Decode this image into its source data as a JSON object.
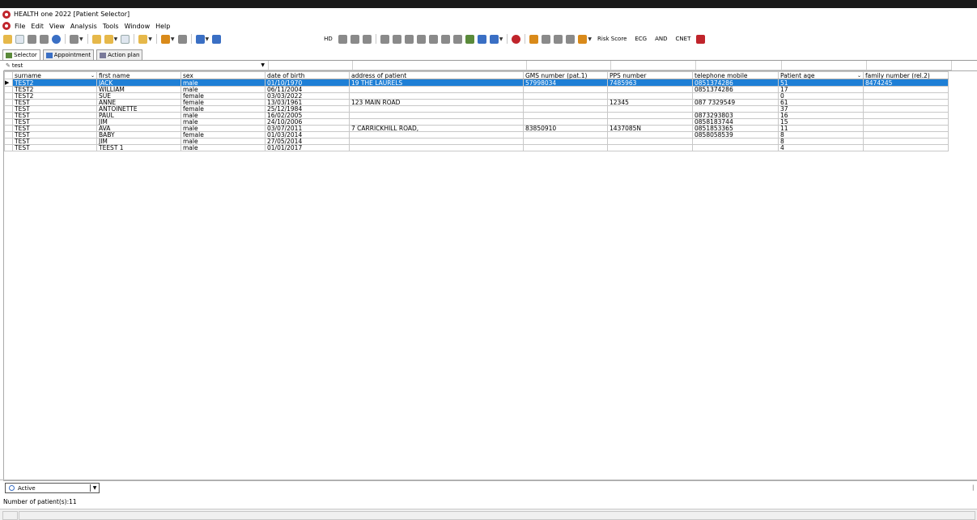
{
  "window": {
    "title": "HEALTH one 2022   [Patient Selector]"
  },
  "menu": [
    "File",
    "Edit",
    "View",
    "Analysis",
    "Tools",
    "Window",
    "Help"
  ],
  "toolbar": {
    "risk_score": "Risk Score",
    "ecg": "ECG",
    "and": "AND",
    "cnet": "CNET",
    "hd": "HD"
  },
  "tabs": [
    "Selector",
    "Appointment",
    "Action plan"
  ],
  "search": {
    "value": "test"
  },
  "table": {
    "columns": [
      "surname",
      "first name",
      "sex",
      "date of birth",
      "address of patient",
      "GMS number (pat.1)",
      "PPS number",
      "telephone mobile",
      "Patient age",
      "family number (rel.2)"
    ],
    "rows": [
      [
        "TEST2",
        "JACK",
        "male",
        "01/10/1970",
        "19 THE LAURELS",
        "57998034",
        "7485963",
        "0851374286",
        "51",
        "8474245"
      ],
      [
        "TEST2",
        "WILLIAM",
        "male",
        "06/11/2004",
        "",
        "",
        "",
        "0851374286",
        "17",
        ""
      ],
      [
        "TEST2",
        "SUE",
        "female",
        "03/03/2022",
        "",
        "",
        "",
        "",
        "0",
        ""
      ],
      [
        "TEST",
        "ANNE",
        "female",
        "13/03/1961",
        "123 MAIN ROAD",
        "",
        "12345",
        "087 7329549",
        "61",
        ""
      ],
      [
        "TEST",
        "ANTOINETTE",
        "female",
        "25/12/1984",
        "",
        "",
        "",
        "",
        "37",
        ""
      ],
      [
        "TEST",
        "PAUL",
        "male",
        "16/02/2005",
        "",
        "",
        "",
        "0873293803",
        "16",
        ""
      ],
      [
        "TEST",
        "JIM",
        "male",
        "24/10/2006",
        "",
        "",
        "",
        "0858183744",
        "15",
        ""
      ],
      [
        "TEST",
        "AVA",
        "male",
        "03/07/2011",
        "7 CARRICKHILL ROAD,",
        "83850910",
        "1437085N",
        "0851853365",
        "11",
        ""
      ],
      [
        "TEST",
        "BABY",
        "female",
        "01/03/2014",
        "",
        "",
        "",
        "0858058539",
        "8",
        ""
      ],
      [
        "TEST",
        "JIM",
        "male",
        "27/05/2014",
        "",
        "",
        "",
        "",
        "8",
        ""
      ],
      [
        "TEST",
        "TEEST 1",
        "male",
        "01/01/2017",
        "",
        "",
        "",
        "",
        "4",
        ""
      ]
    ]
  },
  "status_filter": {
    "value": "Active"
  },
  "footer": {
    "patient_count": "Number of patient(s):11"
  },
  "colors": {
    "selection": "#1e7fd6",
    "brand": "#c0242b"
  }
}
